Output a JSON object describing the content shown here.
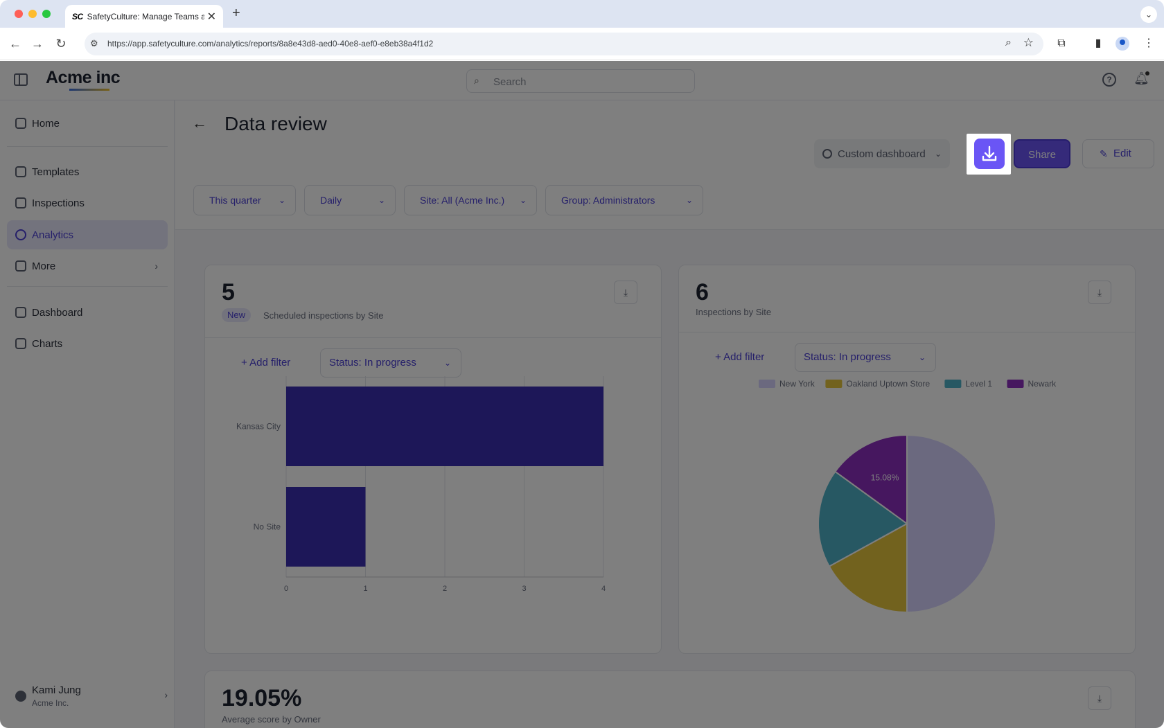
{
  "browser": {
    "tab_favicon": "SC",
    "tab_title": "SafetyCulture: Manage Teams and...",
    "url": "https://app.safetyculture.com/analytics/reports/8a8e43d8-aed0-40e8-aef0-e8eb38a4f1d2"
  },
  "app": {
    "logo": "Acme inc",
    "search_placeholder": "Search"
  },
  "sidebar": {
    "items": [
      {
        "label": "Home"
      },
      {
        "label": "Templates"
      },
      {
        "label": "Inspections"
      },
      {
        "label": "Analytics"
      },
      {
        "label": "More"
      },
      {
        "label": "Dashboard"
      },
      {
        "label": "Charts"
      }
    ],
    "user": {
      "name": "Kami Jung",
      "org": "Acme Inc."
    }
  },
  "header": {
    "title": "Data review",
    "dashboard_select": "Custom dashboard",
    "share_label": "Share",
    "edit_label": "Edit"
  },
  "filters": [
    "This quarter",
    "Daily",
    "Site: All (Acme Inc.)",
    "Group: Administrators"
  ],
  "cards": {
    "scheduled": {
      "value": "5",
      "badge": "New",
      "subtitle": "Scheduled inspections by Site",
      "add_filter": "Add filter",
      "status": "Status: In progress"
    },
    "inspections": {
      "value": "6",
      "subtitle": "Inspections by Site",
      "add_filter": "Add filter",
      "status": "Status: In progress",
      "slice_label": "15.08%"
    },
    "average": {
      "value": "19.05%",
      "subtitle": "Average score by Owner"
    }
  },
  "chart_data": [
    {
      "type": "bar",
      "orientation": "horizontal",
      "categories": [
        "Kansas City",
        "No Site"
      ],
      "values": [
        4,
        1
      ],
      "xlim": [
        0,
        4
      ],
      "xticks": [
        "0",
        "1",
        "2",
        "3",
        "4"
      ],
      "grid": true,
      "colors": [
        "#3a2fb0"
      ]
    },
    {
      "type": "pie",
      "labels": [
        "New York",
        "Oakland Uptown Store",
        "Level 1",
        "Newark"
      ],
      "values": [
        50,
        17,
        18,
        15
      ],
      "colors": [
        "#d6d2ff",
        "#e5c53c",
        "#4fb0c6",
        "#8d2fbf"
      ],
      "legend": "top",
      "data_labels": [
        "15.08%"
      ]
    }
  ],
  "colors": {
    "accent": "#6a55f5",
    "active_nav": "#e7e6fb"
  }
}
